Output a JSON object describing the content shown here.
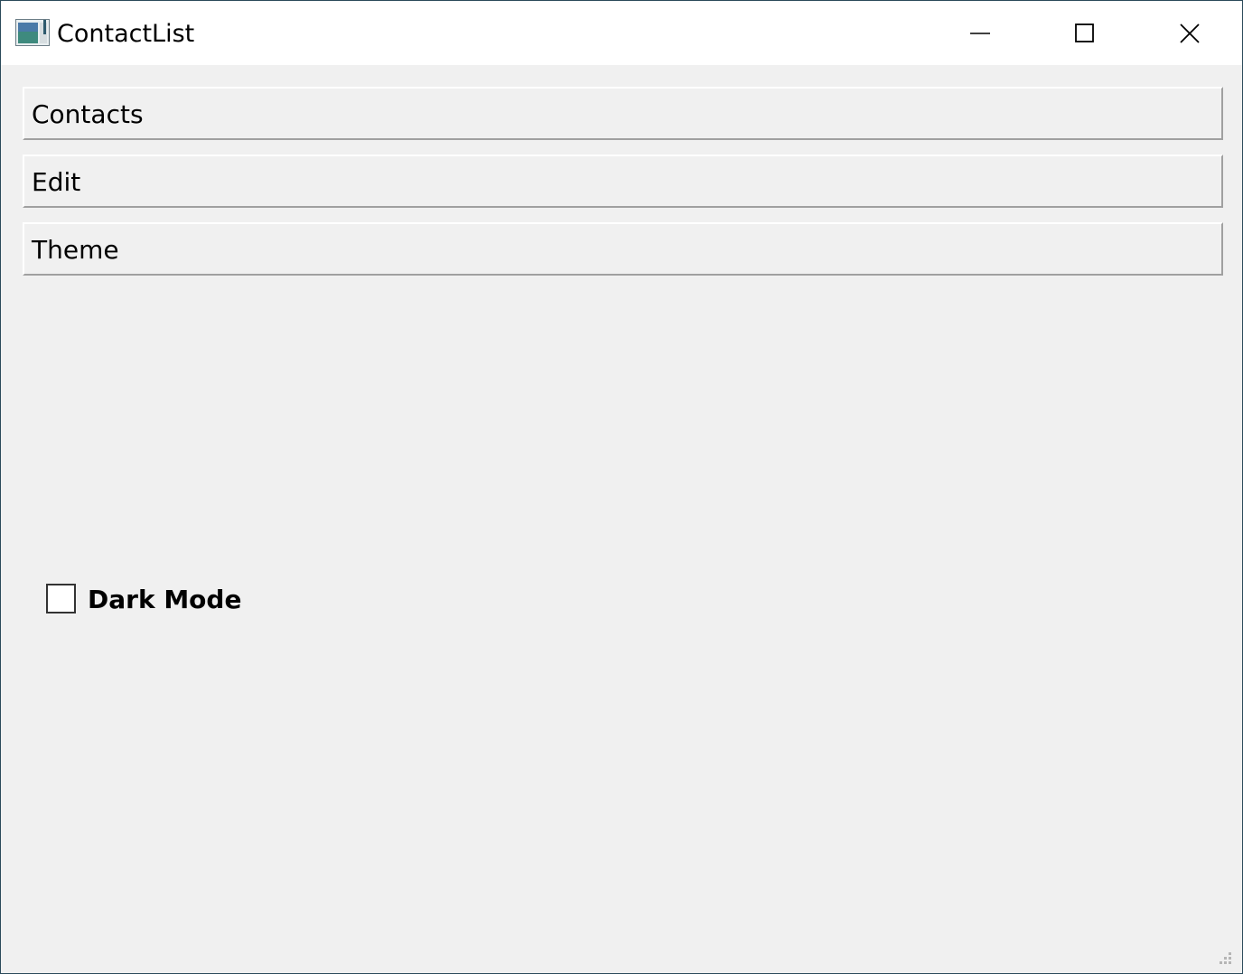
{
  "window": {
    "title": "ContactList",
    "app_icon": "window-app-icon",
    "controls": {
      "minimize_icon": "minimize-icon",
      "maximize_icon": "maximize-icon",
      "close_icon": "close-icon"
    }
  },
  "sections": [
    {
      "label": "Contacts"
    },
    {
      "label": "Edit"
    },
    {
      "label": "Theme"
    }
  ],
  "theme": {
    "dark_mode_label": "Dark Mode",
    "dark_mode_checked": false
  },
  "colors": {
    "window_bg": "#f0f0f0",
    "titlebar_bg": "#ffffff",
    "button_shadow": "#a0a0a0"
  }
}
